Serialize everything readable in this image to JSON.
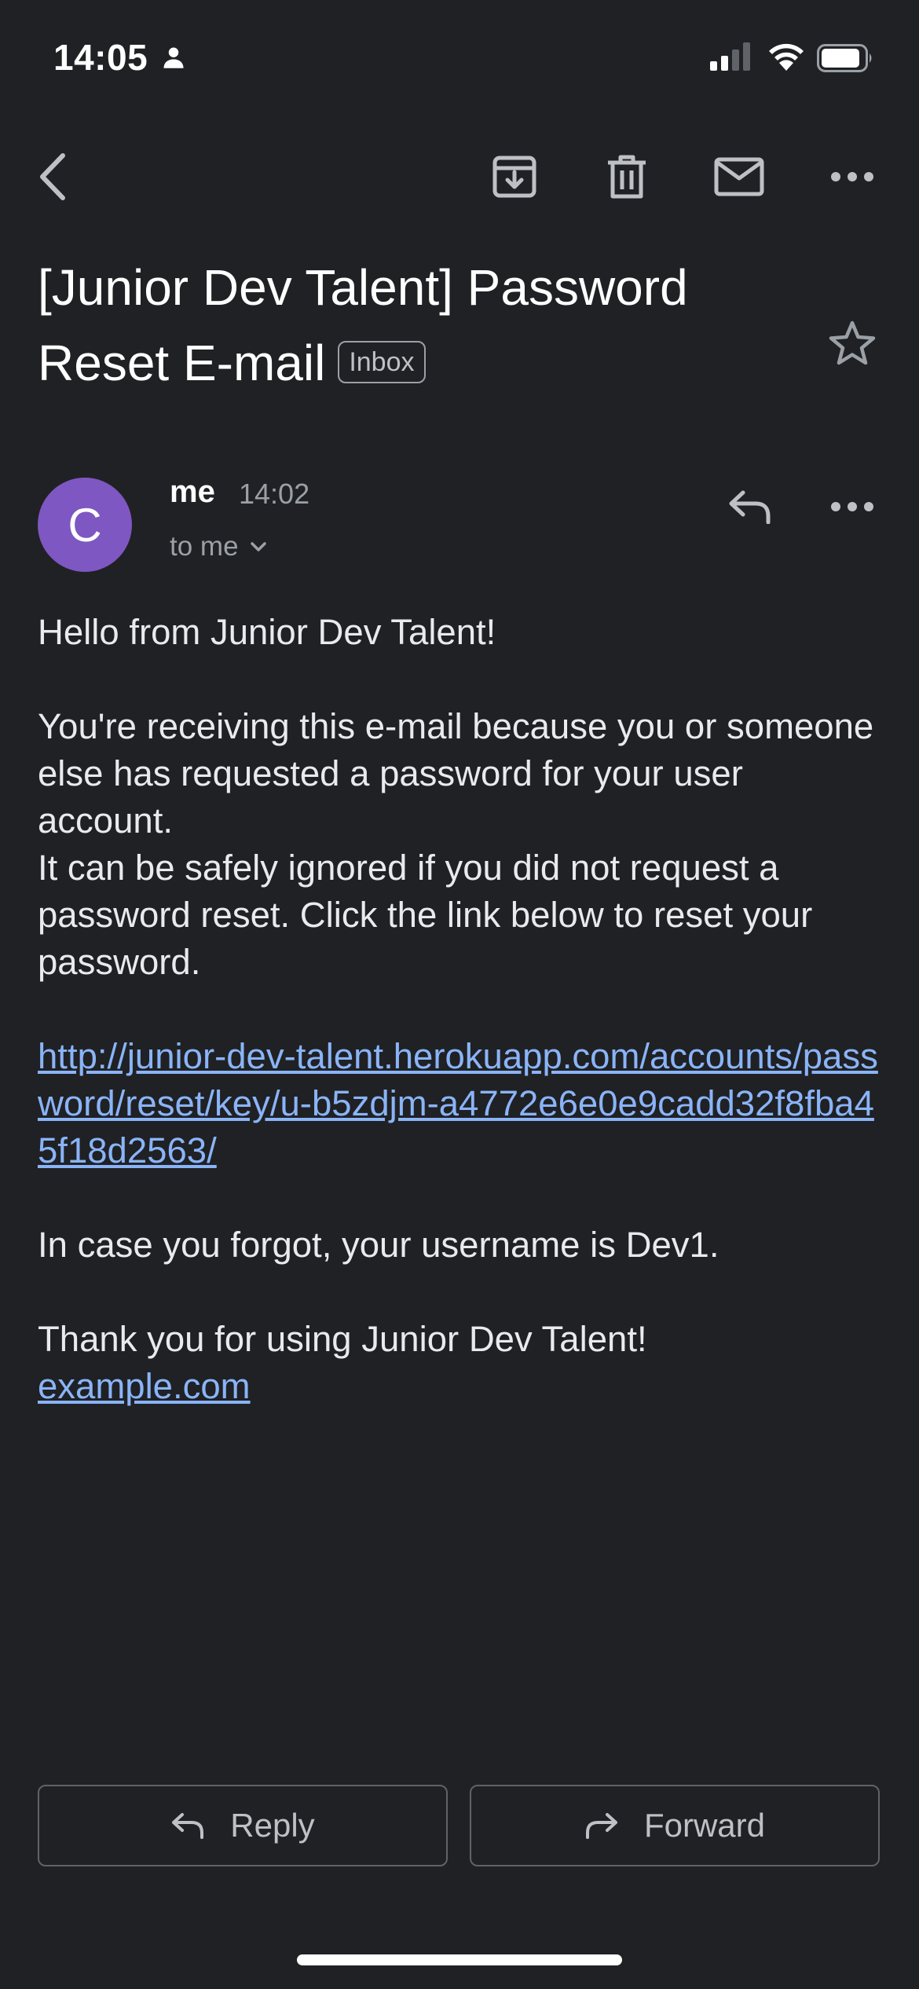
{
  "status_bar": {
    "time": "14:05"
  },
  "email": {
    "subject": "[Junior Dev Talent] Password Reset E-mail",
    "label": "Inbox",
    "sender": {
      "avatar_letter": "C",
      "avatar_color": "#7e57c2",
      "name": "me",
      "time": "14:02",
      "recipient": "to me"
    },
    "body": {
      "greeting": "Hello from Junior Dev Talent!",
      "paragraph1": "You're receiving this e-mail because you or someone else has requested a password for your user account.",
      "paragraph2": "It can be safely ignored if you did not request a password reset. Click the link below to reset your password.",
      "reset_link": "http://junior-dev-talent.herokuapp.com/accounts/password/reset/key/u-b5zdjm-a4772e6e0e9cadd32f8fba45f18d2563/",
      "username_note": "In case you forgot, your username is Dev1.",
      "thanks": "Thank you for using Junior Dev Talent!",
      "site_link": "example.com"
    }
  },
  "actions": {
    "reply_label": "Reply",
    "forward_label": "Forward"
  },
  "colors": {
    "background": "#202124",
    "link": "#8ab4f8",
    "avatar": "#7e57c2"
  },
  "icons": [
    "person-icon",
    "signal-icon",
    "wifi-icon",
    "battery-icon",
    "back-arrow-icon",
    "archive-icon",
    "delete-icon",
    "mail-icon",
    "more-horiz-icon",
    "star-icon",
    "reply-icon",
    "chevron-down-icon",
    "forward-icon"
  ]
}
